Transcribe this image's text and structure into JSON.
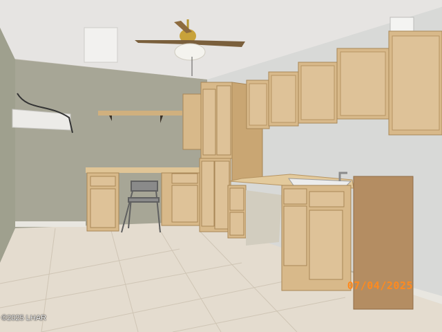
{
  "photo": {
    "date_stamp": "07/04/2025",
    "watermark": "©2025 LHAR"
  },
  "colors": {
    "ceiling": "#e6e4e2",
    "wall_left": "#a6a596",
    "wall_right": "#d6d7d5",
    "cabinet": "#d8b98a",
    "cabinet_dark": "#b89868",
    "floor": "#e4dccf",
    "date_stamp": "#ff8a1e"
  }
}
